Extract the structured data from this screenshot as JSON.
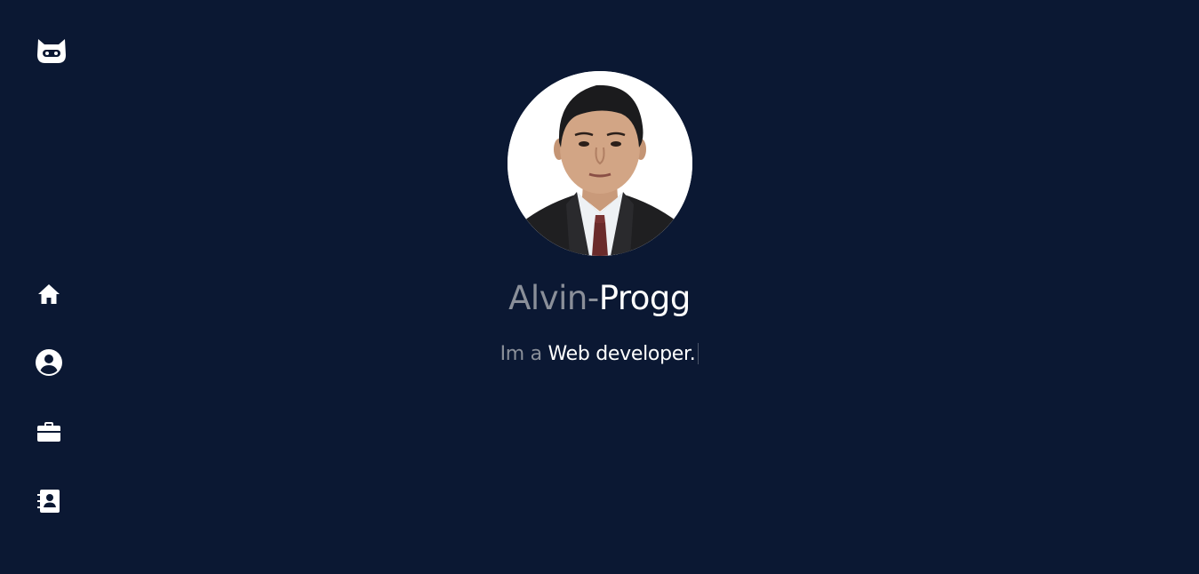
{
  "brand": {
    "logo_icon": "robot-cat-icon"
  },
  "nav": {
    "items": [
      {
        "name": "home",
        "icon": "home-icon"
      },
      {
        "name": "about",
        "icon": "user-circle-icon"
      },
      {
        "name": "portfolio",
        "icon": "briefcase-icon"
      },
      {
        "name": "contact",
        "icon": "contact-book-icon"
      }
    ]
  },
  "hero": {
    "name_part1": "Alvin",
    "name_dash": "-",
    "name_part2": "Progg",
    "tagline_prefix": "Im a",
    "tagline_role": "Web developer."
  },
  "colors": {
    "background": "#0b1833",
    "muted_text": "#8a8f99",
    "highlight_text": "#ffffff"
  }
}
